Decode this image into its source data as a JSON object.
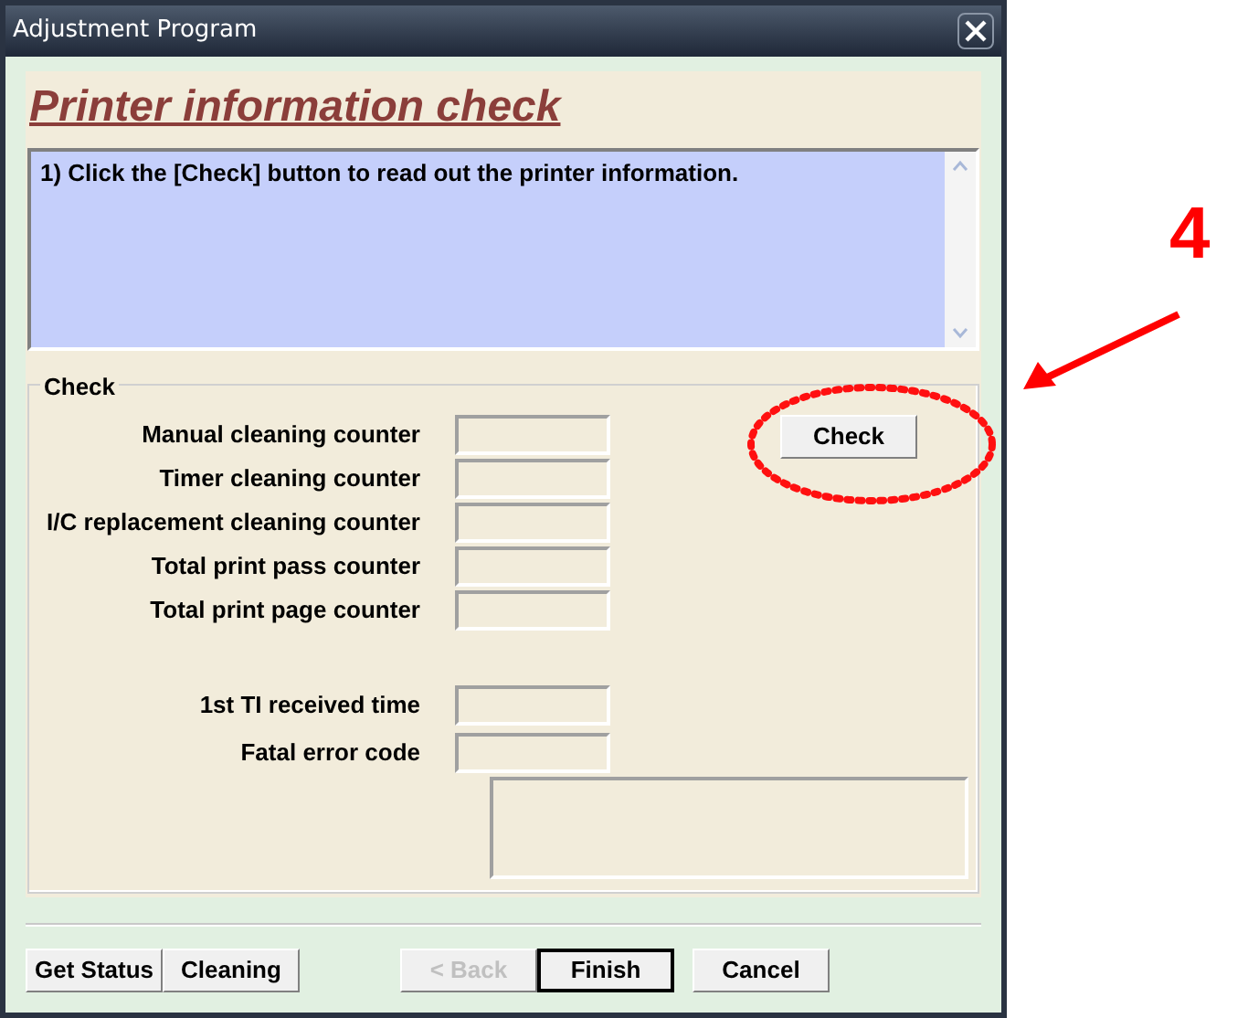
{
  "window": {
    "title": "Adjustment Program"
  },
  "heading": "Printer information check",
  "instructions": "1) Click the [Check] button to read out the printer information.",
  "check_group": {
    "title": "Check",
    "counters": [
      {
        "label": "Manual cleaning counter"
      },
      {
        "label": "Timer cleaning counter"
      },
      {
        "label": "I/C replacement cleaning counter"
      },
      {
        "label": "Total print pass counter"
      },
      {
        "label": "Total print page counter"
      }
    ],
    "details": [
      {
        "label": "1st TI received time"
      },
      {
        "label": "Fatal error code"
      }
    ],
    "check_button": "Check"
  },
  "button_groups": [
    [
      {
        "label": "Get Status",
        "disabled": false,
        "default": false
      },
      {
        "label": "Cleaning",
        "disabled": false,
        "default": false
      }
    ],
    [
      {
        "label": "< Back",
        "disabled": true,
        "default": false
      },
      {
        "label": "Finish",
        "disabled": false,
        "default": true
      }
    ],
    [
      {
        "label": "Cancel",
        "disabled": false,
        "default": false
      }
    ]
  ],
  "annotation": {
    "step": "4"
  }
}
